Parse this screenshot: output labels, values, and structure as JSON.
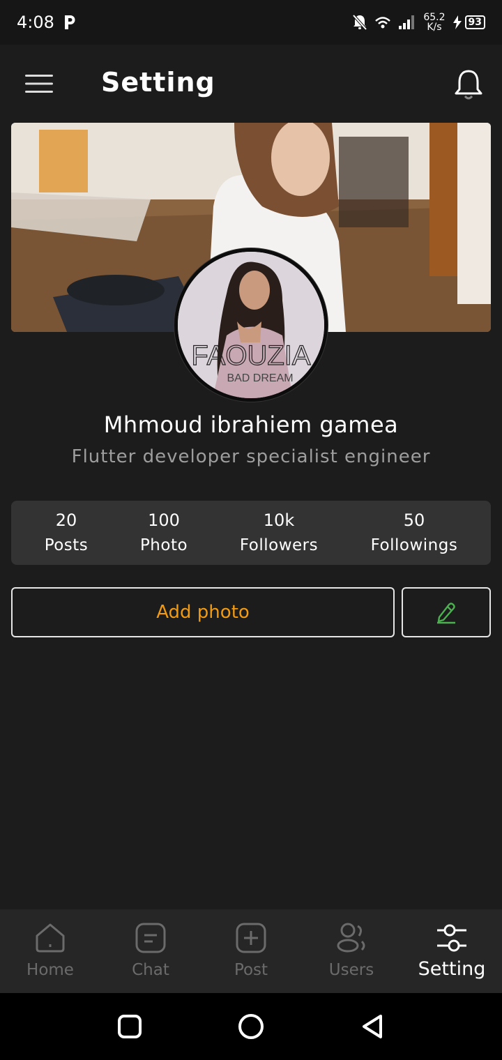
{
  "status_bar": {
    "time": "4:08",
    "net_speed_value": "65.2",
    "net_speed_unit": "K/s",
    "battery": "93"
  },
  "header": {
    "title": "Setting"
  },
  "profile": {
    "name": "Mhmoud ibrahiem gamea",
    "bio": "Flutter developer specialist engineer",
    "avatar_text": "FAOUZIA",
    "avatar_subtext": "BAD DREAM"
  },
  "stats": [
    {
      "value": "20",
      "label": "Posts"
    },
    {
      "value": "100",
      "label": "Photo"
    },
    {
      "value": "10k",
      "label": "Followers"
    },
    {
      "value": "50",
      "label": "Followings"
    }
  ],
  "actions": {
    "add_photo_label": "Add photo"
  },
  "bottom_nav": {
    "items": [
      {
        "label": "Home",
        "icon": "home-icon"
      },
      {
        "label": "Chat",
        "icon": "chat-icon"
      },
      {
        "label": "Post",
        "icon": "add-post-icon"
      },
      {
        "label": "Users",
        "icon": "users-icon"
      },
      {
        "label": "Setting",
        "icon": "settings-sliders-icon"
      }
    ],
    "active": "Setting"
  },
  "colors": {
    "background": "#1c1c1c",
    "accent_orange": "#f29a11",
    "edit_green": "#4caf50",
    "stats_bg": "#333333"
  }
}
